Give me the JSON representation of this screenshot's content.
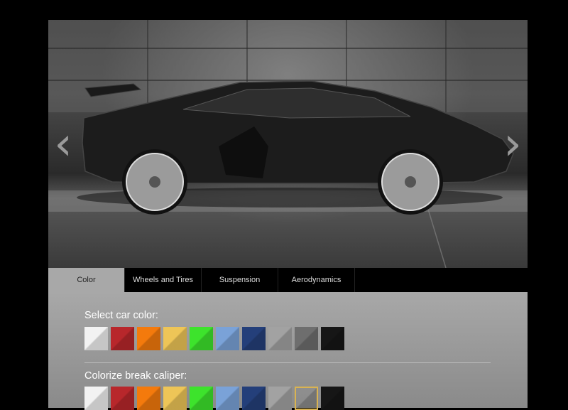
{
  "viewer": {
    "prev_arrow": "‹",
    "next_arrow": "›"
  },
  "tabs": [
    {
      "label": "Color",
      "active": true
    },
    {
      "label": "Wheels and Tires",
      "active": false
    },
    {
      "label": "Suspension",
      "active": false
    },
    {
      "label": "Aerodynamics",
      "active": false
    }
  ],
  "car_color": {
    "title": "Select car color:",
    "swatches": [
      "#f2f2f2",
      "#b8272b",
      "#f47a0c",
      "#eec557",
      "#3de32c",
      "#7aa2d8",
      "#243f7a",
      "#a2a2a2",
      "#6e6e6e",
      "#161616"
    ]
  },
  "caliper_color": {
    "title": "Colorize break caliper:",
    "swatches": [
      "#f2f2f2",
      "#b8272b",
      "#f47a0c",
      "#eec557",
      "#3de32c",
      "#7aa2d8",
      "#243f7a",
      "#a2a2a2",
      "#9a9a9a",
      "#161616"
    ],
    "selected_index": 8
  }
}
